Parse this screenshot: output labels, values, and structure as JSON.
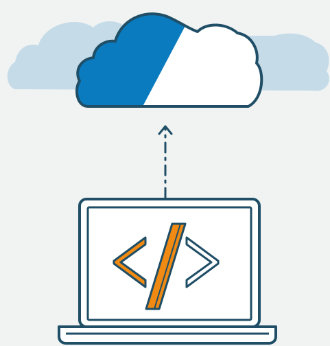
{
  "illustration": {
    "icons": [
      "cloud-icon",
      "upload-arrow-icon",
      "laptop-icon",
      "code-brackets-icon"
    ]
  },
  "colors": {
    "background": "#f1f3f3",
    "cloud_back": "#c5dce8",
    "cloud_blue": "#0a7bbf",
    "cloud_white": "#ffffff",
    "outline": "#1f4e66",
    "code_orange": "#f08a12",
    "code_white": "#ffffff"
  }
}
